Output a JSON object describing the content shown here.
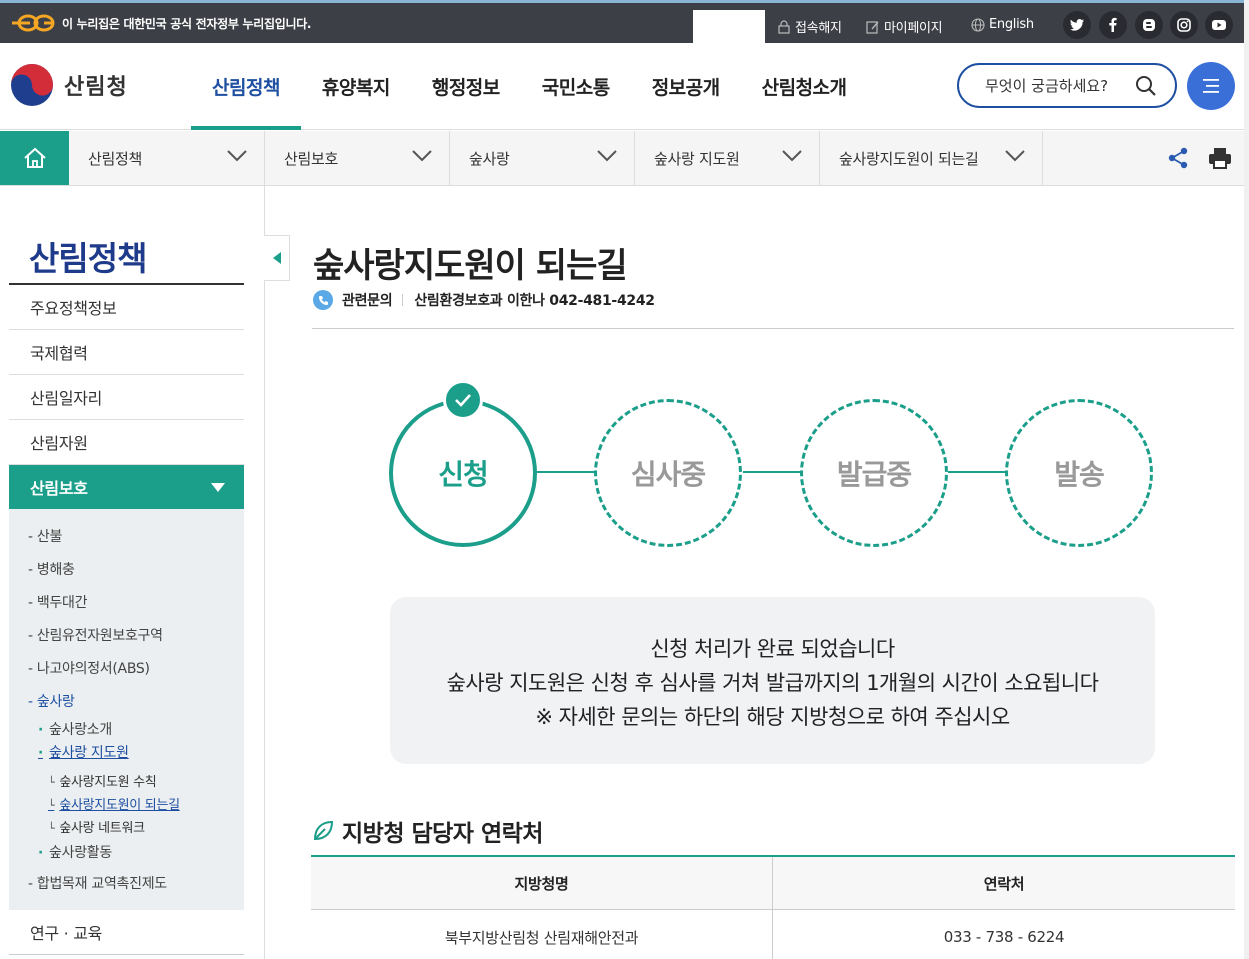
{
  "govbar": {
    "notice": "이 누리집은 대한민국 공식 전자정부 누리집입니다.",
    "logout": "접속해지",
    "mypage": "마이페이지",
    "english": "English"
  },
  "header": {
    "logo_text": "산림청",
    "gnb": [
      "산림정책",
      "휴양복지",
      "행정정보",
      "국민소통",
      "정보공개",
      "산림청소개"
    ],
    "search_placeholder": "무엇이 궁금하세요?"
  },
  "breadcrumb": [
    "산림정책",
    "산림보호",
    "숲사랑",
    "숲사랑 지도원",
    "숲사랑지도원이 되는길"
  ],
  "lnb": {
    "title": "산림정책",
    "items": [
      "주요정책정보",
      "국제협력",
      "산림일자리",
      "산림자원",
      "산림보호"
    ],
    "sub1": [
      "- 산불",
      "- 병해충",
      "- 백두대간",
      "- 산림유전자원보호구역",
      "- 나고야의정서(ABS)",
      "- 숲사랑"
    ],
    "sub2": [
      "숲사랑소개",
      "숲사랑 지도원"
    ],
    "sub3": [
      "숲사랑지도원 수칙",
      "숲사랑지도원이 되는길",
      "숲사랑 네트워크"
    ],
    "sub2b": "숲사랑활동",
    "sub1b": "- 합법목재 교역촉진제도",
    "last": "연구 · 교육"
  },
  "main": {
    "title": "숲사랑지도원이 되는길",
    "inquiry_label": "관련문의",
    "inquiry_value": "산림환경보호과 이한나 042-481-4242",
    "steps": [
      "신청",
      "심사중",
      "발급중",
      "발송"
    ],
    "message": [
      "신청 처리가 완료 되었습니다",
      "숲사랑 지도원은 신청 후 심사를 거쳐 발급까지의 1개월의 시간이 소요됩니다",
      "※ 자세한 문의는 하단의 해당 지방청으로 하여 주십시오"
    ],
    "section_title": "지방청 담당자 연락처",
    "table": {
      "headers": [
        "지방청명",
        "연락처"
      ],
      "rows": [
        [
          "북부지방산림청 산림재해안전과",
          "033 - 738 - 6224"
        ]
      ]
    }
  },
  "colors": {
    "accent": "#1b9e8a",
    "brand": "#1e4fa1"
  }
}
